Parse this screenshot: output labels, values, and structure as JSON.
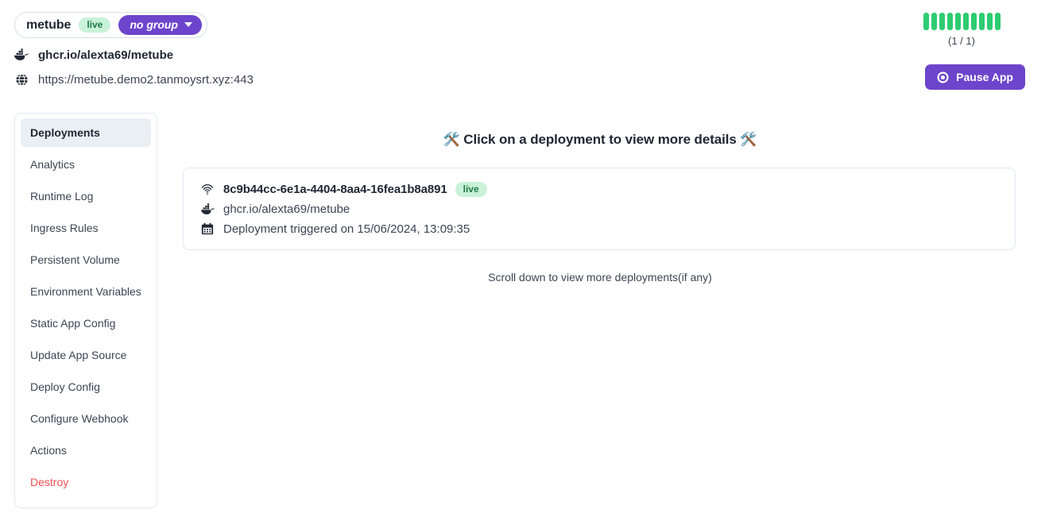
{
  "header": {
    "app_name": "metube",
    "status_badge": "live",
    "group_label": "no group",
    "docker_image": "ghcr.io/alexta69/metube",
    "app_url": "https://metube.demo2.tanmoysrt.xyz:443",
    "docker_icon": "docker-whale-icon",
    "globe_icon": "globe-icon",
    "caret_icon": "chevron-down-icon"
  },
  "status": {
    "replica_bars": 10,
    "replica_count_label": "(1 / 1)",
    "bar_color": "#2ecc71",
    "pause_button_label": "Pause App",
    "pause_icon": "stop-circle-icon",
    "accent_color": "#6d45cc"
  },
  "sidebar": {
    "items": [
      {
        "label": "Deployments",
        "active": true,
        "danger": false
      },
      {
        "label": "Analytics",
        "active": false,
        "danger": false
      },
      {
        "label": "Runtime Log",
        "active": false,
        "danger": false
      },
      {
        "label": "Ingress Rules",
        "active": false,
        "danger": false
      },
      {
        "label": "Persistent Volume",
        "active": false,
        "danger": false
      },
      {
        "label": "Environment Variables",
        "active": false,
        "danger": false
      },
      {
        "label": "Static App Config",
        "active": false,
        "danger": false
      },
      {
        "label": "Update App Source",
        "active": false,
        "danger": false
      },
      {
        "label": "Deploy Config",
        "active": false,
        "danger": false
      },
      {
        "label": "Configure Webhook",
        "active": false,
        "danger": false
      },
      {
        "label": "Actions",
        "active": false,
        "danger": false
      },
      {
        "label": "Destroy",
        "active": false,
        "danger": true
      }
    ]
  },
  "main": {
    "title": "🛠️ Click on a deployment to view more details 🛠️",
    "scroll_hint": "Scroll down to view more deployments(if any)",
    "deployments": [
      {
        "id": "8c9b44cc-6e1a-4404-8aa4-16fea1b8a891",
        "status_badge": "live",
        "image": "ghcr.io/alexta69/metube",
        "triggered_text": "Deployment triggered on 15/06/2024, 13:09:35",
        "id_icon": "fingerprint-icon",
        "image_icon": "docker-whale-icon",
        "date_icon": "calendar-icon"
      }
    ]
  }
}
